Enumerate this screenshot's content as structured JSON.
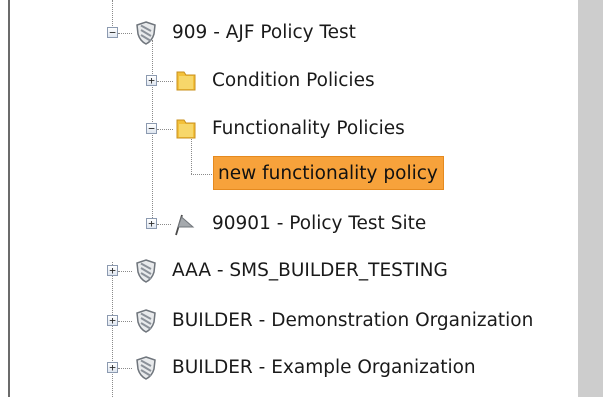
{
  "tree": {
    "items": [
      {
        "label": "909 - AJF Policy Test",
        "icon": "shield-icon",
        "state": "expanded"
      },
      {
        "label": "Condition Policies",
        "icon": "folder-icon",
        "state": "collapsed"
      },
      {
        "label": "Functionality Policies",
        "icon": "folder-open-icon",
        "state": "expanded"
      },
      {
        "label": "new functionality policy",
        "icon": "none",
        "state": "selected"
      },
      {
        "label": "90901 - Policy Test Site",
        "icon": "flag-icon",
        "state": "collapsed"
      },
      {
        "label": "AAA - SMS_BUILDER_TESTING",
        "icon": "shield-icon",
        "state": "collapsed"
      },
      {
        "label": "BUILDER - Demonstration Organization",
        "icon": "shield-icon",
        "state": "collapsed"
      },
      {
        "label": "BUILDER - Example Organization",
        "icon": "shield-icon",
        "state": "collapsed"
      }
    ],
    "expander_expanded": "−",
    "expander_collapsed": "+"
  },
  "colors": {
    "selection": "#f7a23b",
    "folder": "#f3c13a",
    "shield": "#9aa0a6",
    "scrollbar": "#cdcdcd"
  }
}
